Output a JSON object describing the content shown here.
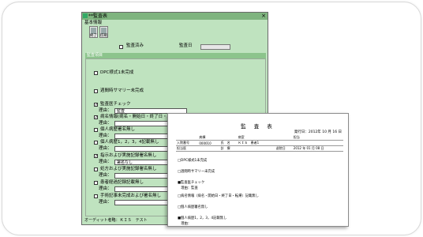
{
  "back_window": {
    "title": "**監査表",
    "menu": "基本情報",
    "toolbar": [
      {
        "label": "終了"
      },
      {
        "label": "印刷"
      }
    ],
    "audited_label": "監査済み",
    "audit_date_label": "監査日",
    "panel_header": "監査項目",
    "items": [
      {
        "label": "DPC様式1未完成",
        "checked": false
      },
      {
        "label": "週間時サマリー未完成",
        "checked": false
      },
      {
        "label": "監査医チェック",
        "checked": true,
        "reason_label": "理由：",
        "reason": "監査"
      },
      {
        "label": "病名情報(病名・開始日・終了日・転帰)記載無し",
        "checked": true,
        "reason_label": "理由："
      },
      {
        "label": "個人病歴署名無し",
        "checked": false,
        "reason_label": "理由："
      },
      {
        "label": "個人病歴1，2，3，4記載無し",
        "checked": false,
        "reason_label": "理由："
      },
      {
        "label": "指示および実施記録署名無し",
        "checked": true,
        "reason_label": "理由：",
        "reason": "署名なし"
      },
      {
        "label": "処方および実施記録署名無し",
        "checked": false,
        "reason_label": "理由："
      },
      {
        "label": "患者経過記録記載無し",
        "checked": false,
        "reason_label": "理由："
      },
      {
        "label": "手術記事未完成および署名無し",
        "checked": false,
        "reason_label": "理由："
      }
    ],
    "status": "オーディット者略：ＫＩＳ　テスト"
  },
  "report": {
    "title": "監 査 表",
    "date": "発行日：2012年 10 月 16 日",
    "header_row1": [
      "",
      "病棟",
      "",
      "病室",
      "",
      "",
      "担当"
    ],
    "header_row2": [
      "入院番号",
      "000010",
      "氏　名",
      "ＫＩＳ　患者1",
      "",
      "",
      ""
    ],
    "header_row3": [
      "担当医",
      "",
      "診　療",
      "",
      "",
      "退院日",
      "2012 年 01 月 08 日"
    ],
    "lines": [
      "□DPC様式1未完成",
      "□週間時サマリー未完成",
      "■監査医チェック",
      "　理由：監査",
      "□病名情報（病名・開始日・終了日・転帰）記載無し",
      "□個人病歴署名無し",
      "■個人病歴1，2，3，4記載無し",
      "　理由："
    ]
  }
}
